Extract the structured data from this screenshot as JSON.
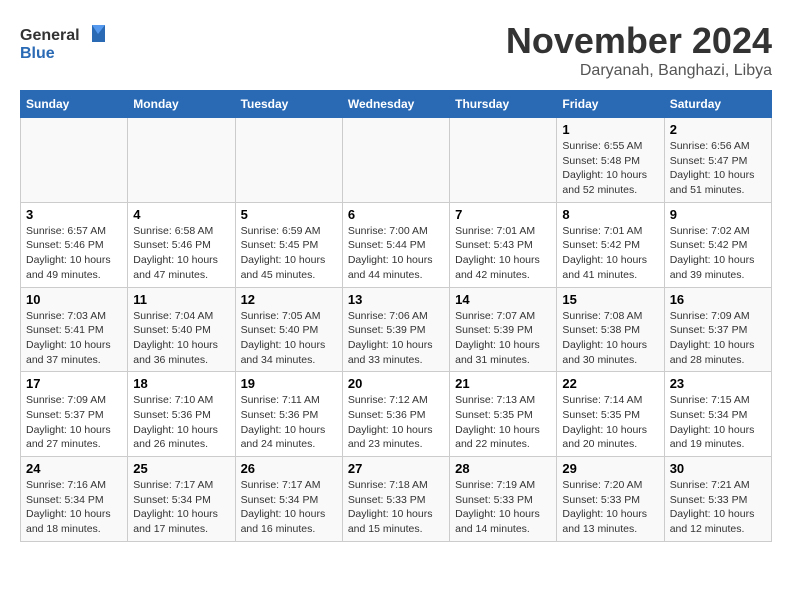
{
  "header": {
    "logo_general": "General",
    "logo_blue": "Blue",
    "month": "November 2024",
    "location": "Daryanah, Banghazi, Libya"
  },
  "columns": [
    "Sunday",
    "Monday",
    "Tuesday",
    "Wednesday",
    "Thursday",
    "Friday",
    "Saturday"
  ],
  "weeks": [
    [
      {
        "day": "",
        "info": ""
      },
      {
        "day": "",
        "info": ""
      },
      {
        "day": "",
        "info": ""
      },
      {
        "day": "",
        "info": ""
      },
      {
        "day": "",
        "info": ""
      },
      {
        "day": "1",
        "info": "Sunrise: 6:55 AM\nSunset: 5:48 PM\nDaylight: 10 hours and 52 minutes."
      },
      {
        "day": "2",
        "info": "Sunrise: 6:56 AM\nSunset: 5:47 PM\nDaylight: 10 hours and 51 minutes."
      }
    ],
    [
      {
        "day": "3",
        "info": "Sunrise: 6:57 AM\nSunset: 5:46 PM\nDaylight: 10 hours and 49 minutes."
      },
      {
        "day": "4",
        "info": "Sunrise: 6:58 AM\nSunset: 5:46 PM\nDaylight: 10 hours and 47 minutes."
      },
      {
        "day": "5",
        "info": "Sunrise: 6:59 AM\nSunset: 5:45 PM\nDaylight: 10 hours and 45 minutes."
      },
      {
        "day": "6",
        "info": "Sunrise: 7:00 AM\nSunset: 5:44 PM\nDaylight: 10 hours and 44 minutes."
      },
      {
        "day": "7",
        "info": "Sunrise: 7:01 AM\nSunset: 5:43 PM\nDaylight: 10 hours and 42 minutes."
      },
      {
        "day": "8",
        "info": "Sunrise: 7:01 AM\nSunset: 5:42 PM\nDaylight: 10 hours and 41 minutes."
      },
      {
        "day": "9",
        "info": "Sunrise: 7:02 AM\nSunset: 5:42 PM\nDaylight: 10 hours and 39 minutes."
      }
    ],
    [
      {
        "day": "10",
        "info": "Sunrise: 7:03 AM\nSunset: 5:41 PM\nDaylight: 10 hours and 37 minutes."
      },
      {
        "day": "11",
        "info": "Sunrise: 7:04 AM\nSunset: 5:40 PM\nDaylight: 10 hours and 36 minutes."
      },
      {
        "day": "12",
        "info": "Sunrise: 7:05 AM\nSunset: 5:40 PM\nDaylight: 10 hours and 34 minutes."
      },
      {
        "day": "13",
        "info": "Sunrise: 7:06 AM\nSunset: 5:39 PM\nDaylight: 10 hours and 33 minutes."
      },
      {
        "day": "14",
        "info": "Sunrise: 7:07 AM\nSunset: 5:39 PM\nDaylight: 10 hours and 31 minutes."
      },
      {
        "day": "15",
        "info": "Sunrise: 7:08 AM\nSunset: 5:38 PM\nDaylight: 10 hours and 30 minutes."
      },
      {
        "day": "16",
        "info": "Sunrise: 7:09 AM\nSunset: 5:37 PM\nDaylight: 10 hours and 28 minutes."
      }
    ],
    [
      {
        "day": "17",
        "info": "Sunrise: 7:09 AM\nSunset: 5:37 PM\nDaylight: 10 hours and 27 minutes."
      },
      {
        "day": "18",
        "info": "Sunrise: 7:10 AM\nSunset: 5:36 PM\nDaylight: 10 hours and 26 minutes."
      },
      {
        "day": "19",
        "info": "Sunrise: 7:11 AM\nSunset: 5:36 PM\nDaylight: 10 hours and 24 minutes."
      },
      {
        "day": "20",
        "info": "Sunrise: 7:12 AM\nSunset: 5:36 PM\nDaylight: 10 hours and 23 minutes."
      },
      {
        "day": "21",
        "info": "Sunrise: 7:13 AM\nSunset: 5:35 PM\nDaylight: 10 hours and 22 minutes."
      },
      {
        "day": "22",
        "info": "Sunrise: 7:14 AM\nSunset: 5:35 PM\nDaylight: 10 hours and 20 minutes."
      },
      {
        "day": "23",
        "info": "Sunrise: 7:15 AM\nSunset: 5:34 PM\nDaylight: 10 hours and 19 minutes."
      }
    ],
    [
      {
        "day": "24",
        "info": "Sunrise: 7:16 AM\nSunset: 5:34 PM\nDaylight: 10 hours and 18 minutes."
      },
      {
        "day": "25",
        "info": "Sunrise: 7:17 AM\nSunset: 5:34 PM\nDaylight: 10 hours and 17 minutes."
      },
      {
        "day": "26",
        "info": "Sunrise: 7:17 AM\nSunset: 5:34 PM\nDaylight: 10 hours and 16 minutes."
      },
      {
        "day": "27",
        "info": "Sunrise: 7:18 AM\nSunset: 5:33 PM\nDaylight: 10 hours and 15 minutes."
      },
      {
        "day": "28",
        "info": "Sunrise: 7:19 AM\nSunset: 5:33 PM\nDaylight: 10 hours and 14 minutes."
      },
      {
        "day": "29",
        "info": "Sunrise: 7:20 AM\nSunset: 5:33 PM\nDaylight: 10 hours and 13 minutes."
      },
      {
        "day": "30",
        "info": "Sunrise: 7:21 AM\nSunset: 5:33 PM\nDaylight: 10 hours and 12 minutes."
      }
    ]
  ]
}
